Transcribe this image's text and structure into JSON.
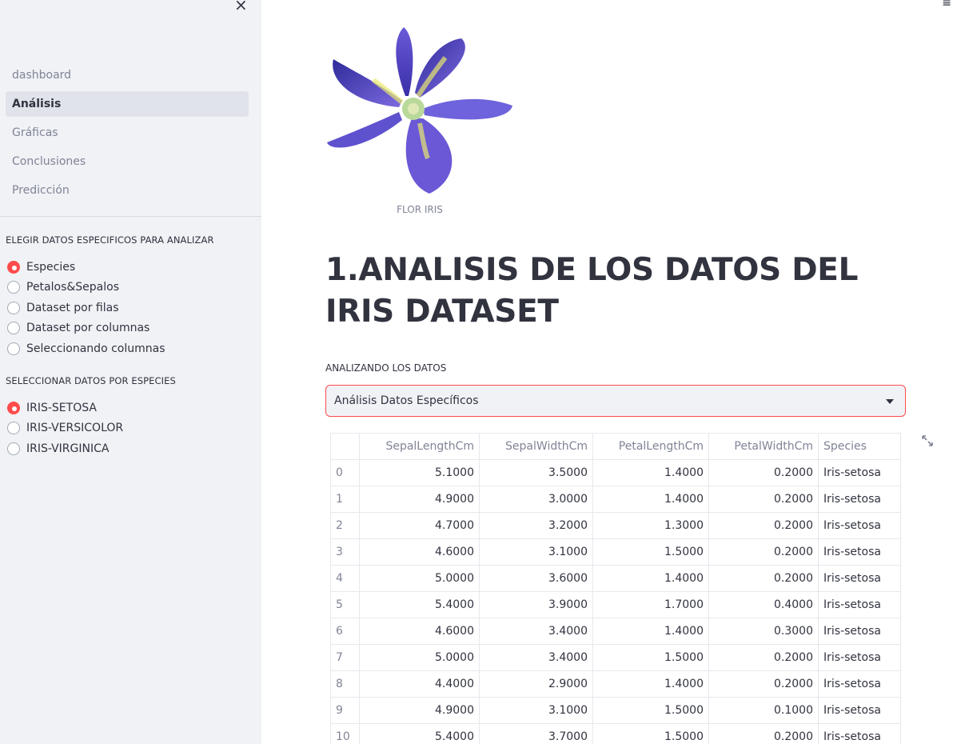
{
  "sidebar": {
    "nav": [
      "dashboard",
      "Análisis",
      "Gráficas",
      "Conclusiones",
      "Predicción"
    ],
    "active_nav": "Análisis",
    "group1": {
      "label": "ELEGIR DATOS ESPECIFICOS PARA ANALIZAR",
      "options": [
        "Especies",
        "Petalos&Sepalos",
        "Dataset por filas",
        "Dataset por columnas",
        "Seleccionando columnas"
      ],
      "selected": "Especies"
    },
    "group2": {
      "label": "SELECCIONAR DATOS POR ESPECIES",
      "options": [
        "IRIS-SETOSA",
        "IRIS-VERSICOLOR",
        "IRIS-VIRGINICA"
      ],
      "selected": "IRIS-SETOSA"
    }
  },
  "main": {
    "image_caption": "FLOR IRIS",
    "title": "1.ANALISIS DE LOS DATOS DEL IRIS DATASET",
    "select_label": "ANALIZANDO LOS DATOS",
    "select_value": "Análisis Datos Específicos"
  },
  "table": {
    "columns": [
      "",
      "SepalLengthCm",
      "SepalWidthCm",
      "PetalLengthCm",
      "PetalWidthCm",
      "Species"
    ],
    "rows": [
      [
        "0",
        "5.1000",
        "3.5000",
        "1.4000",
        "0.2000",
        "Iris-setosa"
      ],
      [
        "1",
        "4.9000",
        "3.0000",
        "1.4000",
        "0.2000",
        "Iris-setosa"
      ],
      [
        "2",
        "4.7000",
        "3.2000",
        "1.3000",
        "0.2000",
        "Iris-setosa"
      ],
      [
        "3",
        "4.6000",
        "3.1000",
        "1.5000",
        "0.2000",
        "Iris-setosa"
      ],
      [
        "4",
        "5.0000",
        "3.6000",
        "1.4000",
        "0.2000",
        "Iris-setosa"
      ],
      [
        "5",
        "5.4000",
        "3.9000",
        "1.7000",
        "0.4000",
        "Iris-setosa"
      ],
      [
        "6",
        "4.6000",
        "3.4000",
        "1.4000",
        "0.3000",
        "Iris-setosa"
      ],
      [
        "7",
        "5.0000",
        "3.4000",
        "1.5000",
        "0.2000",
        "Iris-setosa"
      ],
      [
        "8",
        "4.4000",
        "2.9000",
        "1.4000",
        "0.2000",
        "Iris-setosa"
      ],
      [
        "9",
        "4.9000",
        "3.1000",
        "1.5000",
        "0.1000",
        "Iris-setosa"
      ],
      [
        "10",
        "5.4000",
        "3.7000",
        "1.5000",
        "0.2000",
        "Iris-setosa"
      ]
    ]
  },
  "icons": {
    "close": "close-icon",
    "expand": "fullscreen-expand-icon",
    "caret": "chevron-down-icon",
    "menu": "hamburger-menu-icon"
  },
  "colors": {
    "accent": "#ff4b4b",
    "sidebar_bg": "#f0f2f6",
    "text": "#31333f",
    "muted": "#808495"
  }
}
